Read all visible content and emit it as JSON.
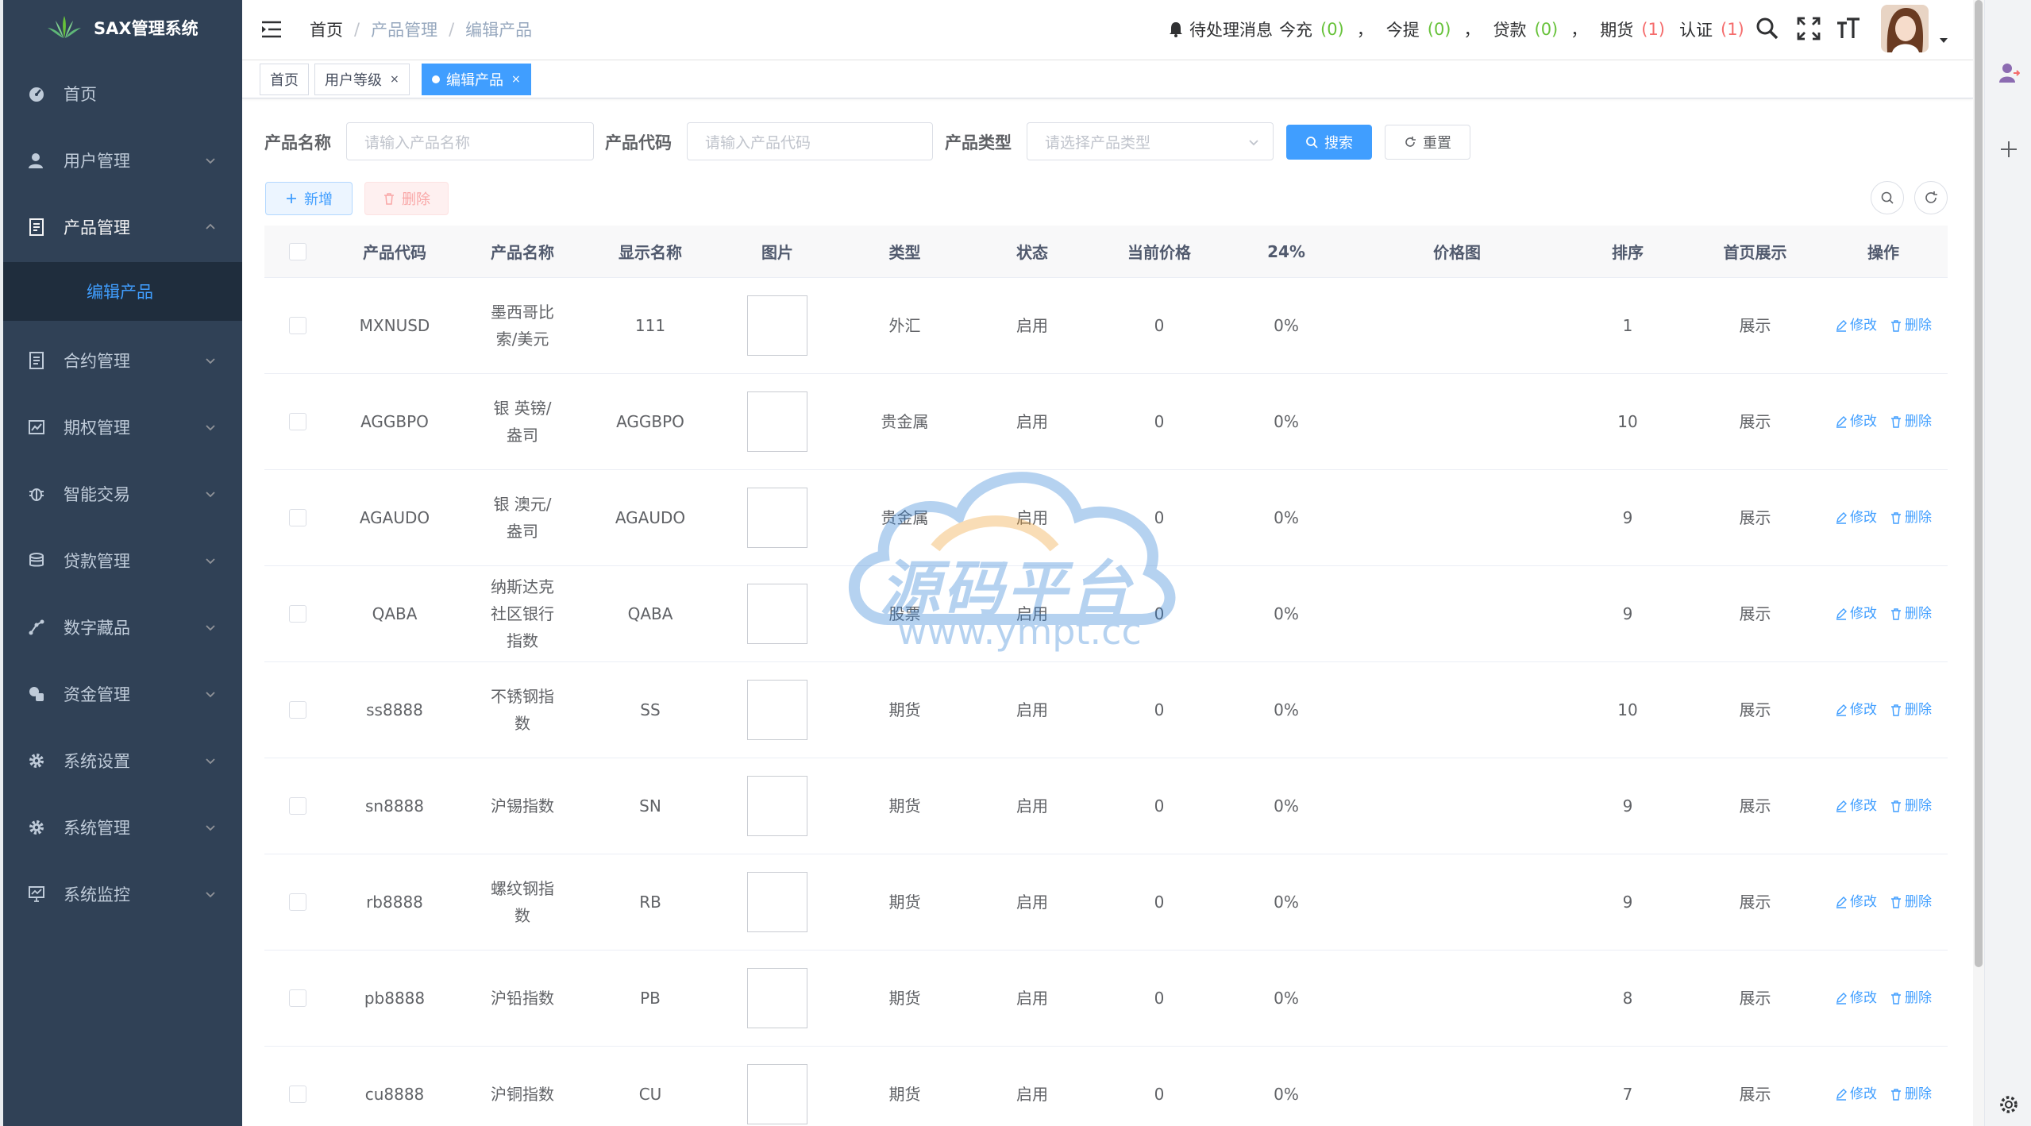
{
  "app": {
    "title": "SAX管理系统"
  },
  "colors": {
    "sidebar_bg": "#304156",
    "primary": "#409eff",
    "danger": "#f56c6c",
    "success": "#67c23a"
  },
  "sidebar": {
    "items": [
      {
        "label": "首页",
        "icon": "dashboard-icon"
      },
      {
        "label": "用户管理",
        "icon": "user-icon"
      },
      {
        "label": "产品管理",
        "icon": "document-icon"
      },
      {
        "label": "合约管理",
        "icon": "contract-icon"
      },
      {
        "label": "期权管理",
        "icon": "chart-icon"
      },
      {
        "label": "智能交易",
        "icon": "bug-icon"
      },
      {
        "label": "贷款管理",
        "icon": "money-icon"
      },
      {
        "label": "数字藏品",
        "icon": "nested-icon"
      },
      {
        "label": "资金管理",
        "icon": "wallet-icon"
      },
      {
        "label": "系统设置",
        "icon": "gear-icon"
      },
      {
        "label": "系统管理",
        "icon": "gear-icon"
      },
      {
        "label": "系统监控",
        "icon": "monitor-icon"
      }
    ],
    "active_sub": "编辑产品"
  },
  "navbar": {
    "breadcrumb": [
      "首页",
      "产品管理",
      "编辑产品"
    ],
    "notice": {
      "label": "待处理消息",
      "today_charge": "今充",
      "today_charge_count": "(0)",
      "today_withdraw": "今提",
      "today_withdraw_count": "(0)",
      "loan": "贷款",
      "loan_count": "(0)",
      "futures": "期货",
      "futures_count": "(1)",
      "auth": "认证",
      "auth_count": "(1)",
      "comma": "，"
    }
  },
  "tags": [
    {
      "label": "首页",
      "closable": false,
      "active": false
    },
    {
      "label": "用户等级",
      "closable": true,
      "active": false
    },
    {
      "label": "编辑产品",
      "closable": true,
      "active": true
    }
  ],
  "tag_close": "×",
  "search": {
    "name_label": "产品名称",
    "name_placeholder": "请输入产品名称",
    "code_label": "产品代码",
    "code_placeholder": "请输入产品代码",
    "type_label": "产品类型",
    "type_placeholder": "请选择产品类型",
    "search_btn": "搜索",
    "reset_btn": "重置"
  },
  "toolbar": {
    "add_btn": "新增",
    "delete_btn": "删除"
  },
  "table": {
    "columns": [
      "产品代码",
      "产品名称",
      "显示名称",
      "图片",
      "类型",
      "状态",
      "当前价格",
      "24%",
      "价格图",
      "排序",
      "首页展示",
      "操作"
    ],
    "edit_label": "修改",
    "delete_label": "删除",
    "rows": [
      {
        "code": "MXNUSD",
        "name": "墨西哥比索/美元",
        "display": "111",
        "type": "外汇",
        "status": "启用",
        "price": "0",
        "change": "0%",
        "sort": "1",
        "home": "展示"
      },
      {
        "code": "AGGBPO",
        "name": "银 英镑/盎司",
        "display": "AGGBPO",
        "type": "贵金属",
        "status": "启用",
        "price": "0",
        "change": "0%",
        "sort": "10",
        "home": "展示"
      },
      {
        "code": "AGAUDO",
        "name": "银 澳元/盎司",
        "display": "AGAUDO",
        "type": "贵金属",
        "status": "启用",
        "price": "0",
        "change": "0%",
        "sort": "9",
        "home": "展示"
      },
      {
        "code": "QABA",
        "name": "纳斯达克社区银行指数",
        "display": "QABA",
        "type": "股票",
        "status": "启用",
        "price": "0",
        "change": "0%",
        "sort": "9",
        "home": "展示"
      },
      {
        "code": "ss8888",
        "name": "不锈钢指数",
        "display": "SS",
        "type": "期货",
        "status": "启用",
        "price": "0",
        "change": "0%",
        "sort": "10",
        "home": "展示"
      },
      {
        "code": "sn8888",
        "name": "沪锡指数",
        "display": "SN",
        "type": "期货",
        "status": "启用",
        "price": "0",
        "change": "0%",
        "sort": "9",
        "home": "展示"
      },
      {
        "code": "rb8888",
        "name": "螺纹钢指数",
        "display": "RB",
        "type": "期货",
        "status": "启用",
        "price": "0",
        "change": "0%",
        "sort": "9",
        "home": "展示"
      },
      {
        "code": "pb8888",
        "name": "沪铅指数",
        "display": "PB",
        "type": "期货",
        "status": "启用",
        "price": "0",
        "change": "0%",
        "sort": "8",
        "home": "展示"
      },
      {
        "code": "cu8888",
        "name": "沪铜指数",
        "display": "CU",
        "type": "期货",
        "status": "启用",
        "price": "0",
        "change": "0%",
        "sort": "7",
        "home": "展示"
      }
    ]
  },
  "watermark": {
    "title": "源码平台",
    "url": "www.ympt.cc"
  }
}
